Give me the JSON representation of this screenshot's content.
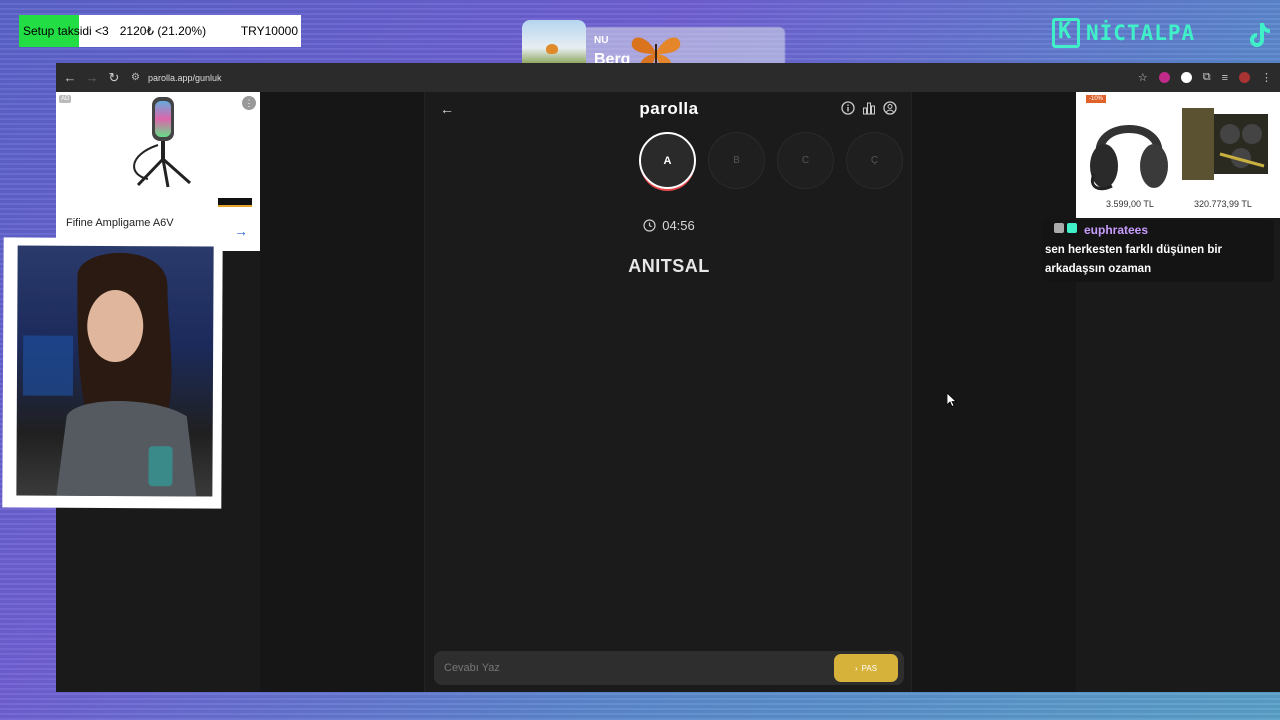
{
  "goal": {
    "label": "Setup taksidi <3",
    "amount": "2120₺ (21.20%)",
    "target": "TRY10000",
    "progress_fraction": 0.212,
    "fill_color": "#22dd44"
  },
  "music": {
    "label": "NU",
    "title": "Berg"
  },
  "brand": {
    "name": "NİCTALPA",
    "color": "#3ff0c8",
    "tiktok_icon": "tiktok-icon"
  },
  "browser": {
    "url": "parolla.app/gunluk",
    "nav_icons": [
      "back-icon",
      "forward-icon",
      "reload-icon"
    ],
    "toolbar_icons": [
      "star-icon",
      "extension-icon",
      "puzzle-icon",
      "menu-icon"
    ]
  },
  "ads": {
    "left": {
      "badge": "AD",
      "title": "Fifine Ampligame A6V"
    },
    "right": {
      "badge": "-10%",
      "price1": "3.599,00 TL",
      "price2": "320.773,99 TL"
    }
  },
  "app": {
    "title": "parolla",
    "icons": [
      "info-icon",
      "stats-icon",
      "profile-icon"
    ],
    "letters": [
      {
        "label": "A",
        "active": true
      },
      {
        "label": "B",
        "active": false
      },
      {
        "label": "C",
        "active": false
      },
      {
        "label": "Ç",
        "active": false
      }
    ],
    "timer": "04:56",
    "word": "ANITSAL",
    "answer_placeholder": "Cevabı Yaz",
    "pass_label": "PAS",
    "accent_color": "#d6b23a",
    "active_ring_color": "#e8474b"
  },
  "chat": {
    "username": "euphratees",
    "username_color": "#c99cff",
    "message": "sen herkesten farklı düşünen bir arkadaşsın ozaman"
  }
}
